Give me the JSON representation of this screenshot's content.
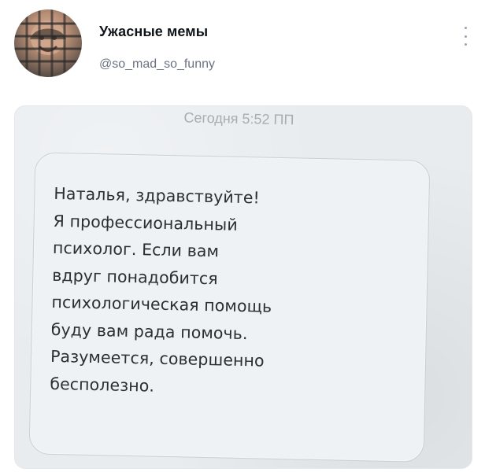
{
  "post": {
    "author_name": "Ужасные мемы",
    "author_handle": "@so_mad_so_funny"
  },
  "media": {
    "sms": {
      "time": "Сегодня 5:52 ПП",
      "message": "Наталья, здравствуйте!\nЯ профессиональный\nпсихолог. Если вам\nвдруг понадобится\nпсихологическая помощь\nбуду вам рада помочь.\nРазумеется, совершенно\nбесполезно."
    }
  },
  "icons": {
    "avatar": "avatar",
    "more": "more-vertical-icon"
  },
  "colors": {
    "handle_text": "#6b7280",
    "media_bg": "#e8ecef",
    "bubble_bg": "#eef2f4",
    "bubble_border": "#c9d0d5",
    "sms_text": "#2a2f33",
    "time_text": "#a6adb3"
  }
}
